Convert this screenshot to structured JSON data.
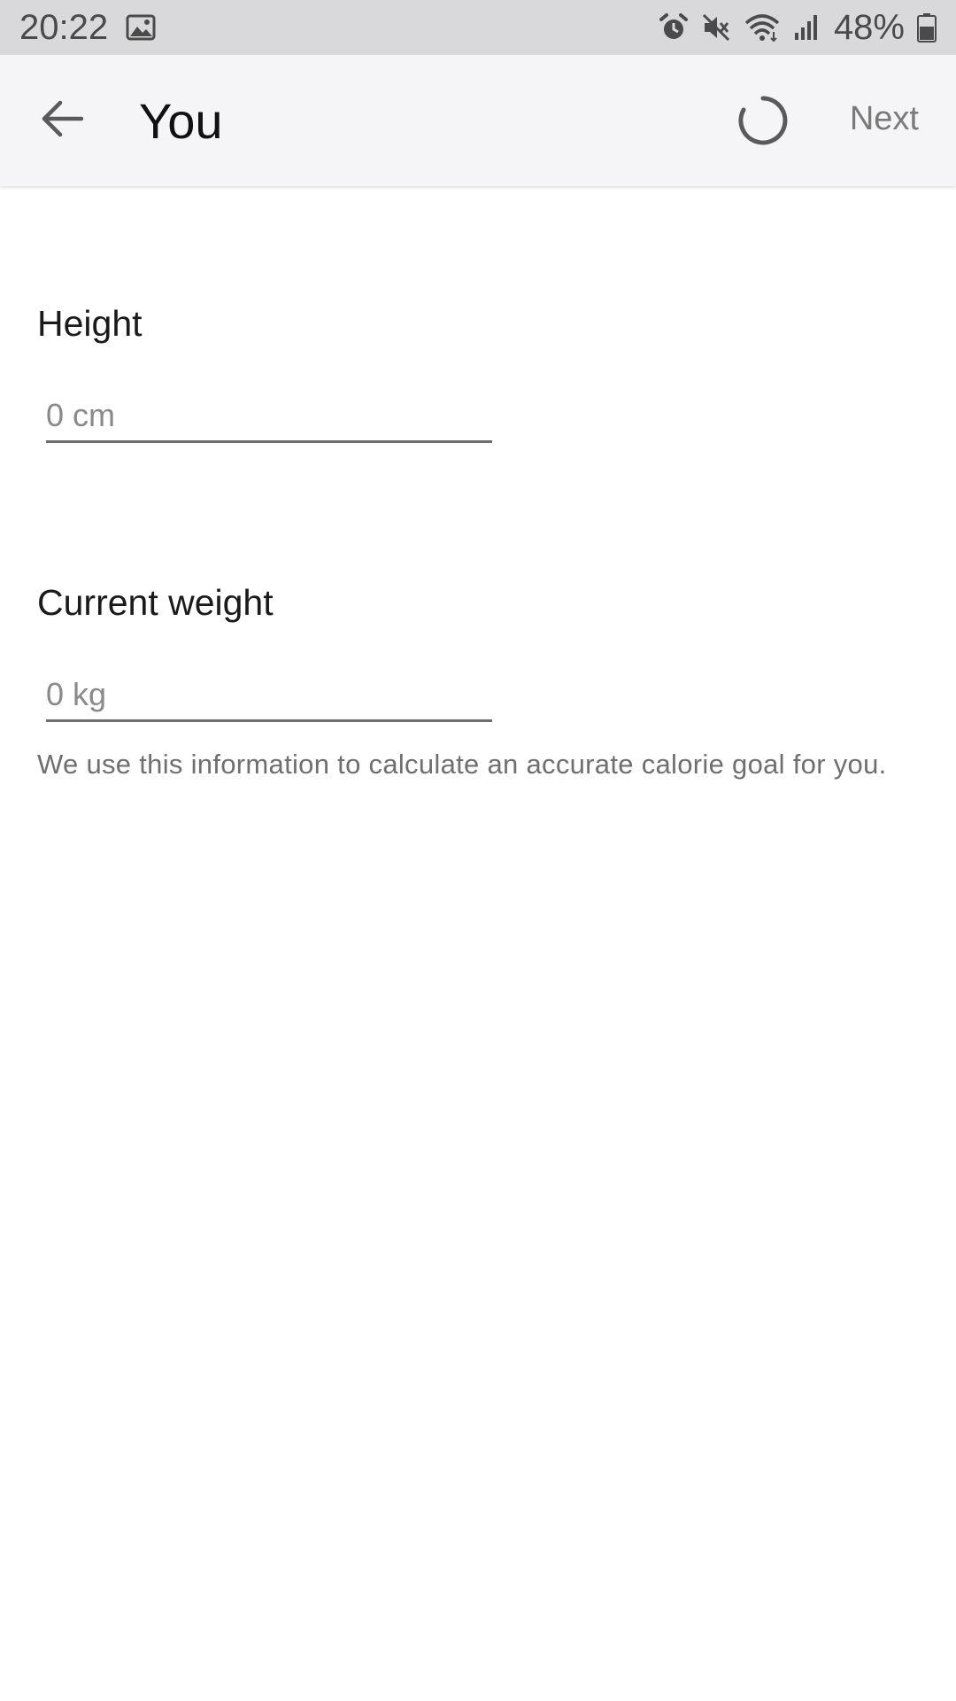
{
  "status_bar": {
    "time": "20:22",
    "battery": "48%",
    "icons": [
      "image-icon",
      "alarm-icon",
      "mute-icon",
      "wifi-icon",
      "signal-icon",
      "battery-icon"
    ]
  },
  "app_bar": {
    "title": "You",
    "next_label": "Next",
    "back_icon": "arrow-left-icon",
    "loading_icon": "spinner-icon"
  },
  "form": {
    "height": {
      "label": "Height",
      "value": "",
      "placeholder": "0 cm"
    },
    "weight": {
      "label": "Current weight",
      "value": "",
      "placeholder": "0 kg"
    },
    "helper": "We use this information to calculate an accurate calorie goal for you."
  },
  "colors": {
    "status_bar_bg": "#d9d9db",
    "app_bar_bg": "#f5f5f7",
    "underline": "#6e6e6e",
    "muted_text": "#7a7a7a"
  }
}
